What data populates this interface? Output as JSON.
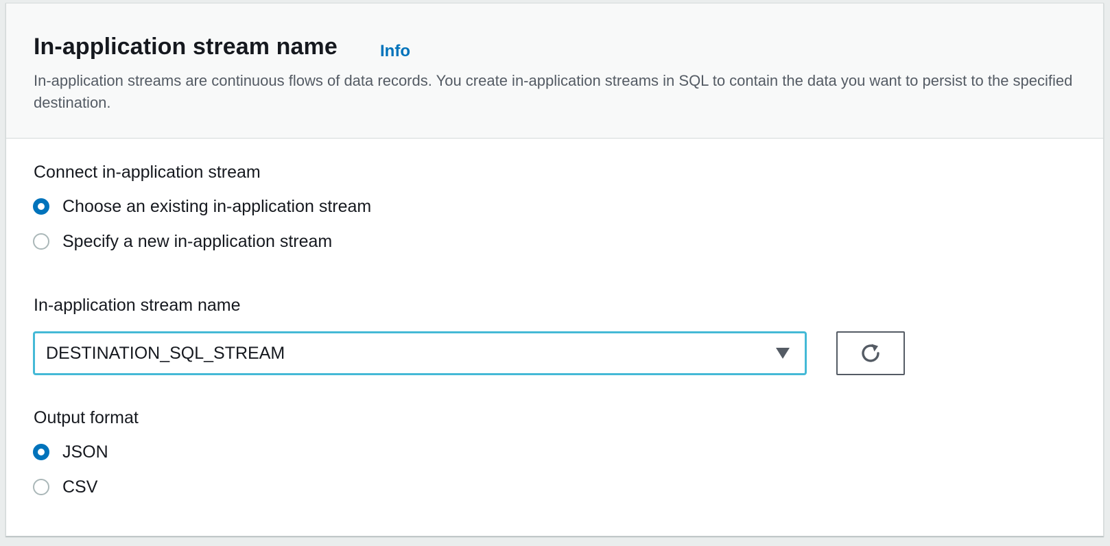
{
  "header": {
    "title": "In-application stream name",
    "info_link": "Info",
    "description": "In-application streams are continuous flows of data records. You create in-application streams in SQL to contain the data you want to persist to the specified destination."
  },
  "connect": {
    "label": "Connect in-application stream",
    "options": [
      {
        "label": "Choose an existing in-application stream",
        "checked": true
      },
      {
        "label": "Specify a new in-application stream",
        "checked": false
      }
    ]
  },
  "stream_name": {
    "label": "In-application stream name",
    "selected_value": "DESTINATION_SQL_STREAM",
    "refresh_icon": "refresh-icon",
    "caret_icon": "caret-down-icon"
  },
  "output_format": {
    "label": "Output format",
    "options": [
      {
        "label": "JSON",
        "checked": true
      },
      {
        "label": "CSV",
        "checked": false
      }
    ]
  },
  "colors": {
    "accent": "#0073bb",
    "focus_border": "#44b9d6",
    "header_bg": "#f8f9f9",
    "text": "#16191f",
    "muted_text": "#545b64"
  }
}
